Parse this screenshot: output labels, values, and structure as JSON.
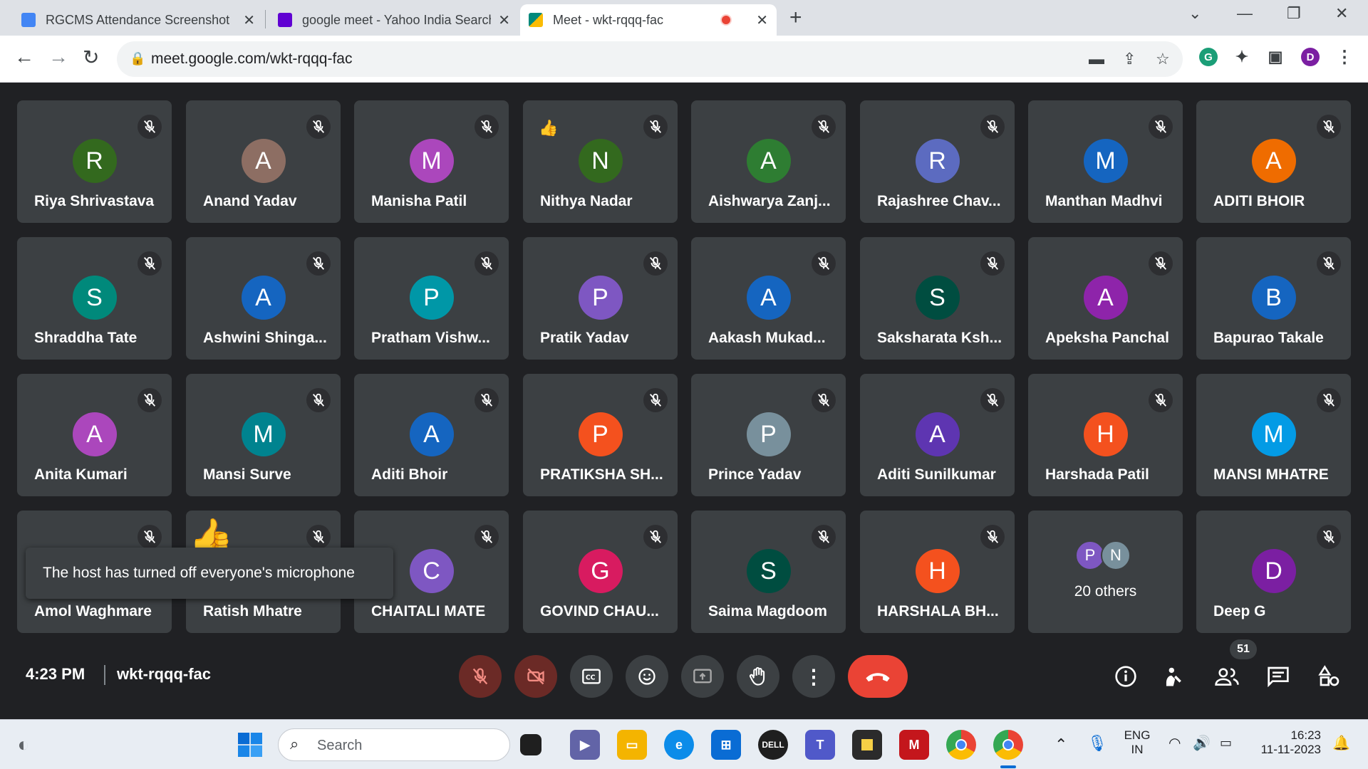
{
  "browser": {
    "tabs": [
      {
        "title": "RGCMS Attendance Screenshot",
        "icon": "docs-icon",
        "color": "#4285f4"
      },
      {
        "title": "google meet - Yahoo India Search",
        "icon": "yahoo-icon",
        "color": "#6001d2"
      },
      {
        "title": "Meet - wkt-rqqq-fac",
        "icon": "meet-icon",
        "color": "#00897b"
      }
    ],
    "url": "meet.google.com/wkt-rqqq-fac",
    "profile_initial": "D"
  },
  "participants": [
    {
      "name": "Riya Shrivastava",
      "initial": "R",
      "color": "#33691e"
    },
    {
      "name": "Anand Yadav",
      "initial": "A",
      "color": "#8d6e63"
    },
    {
      "name": "Manisha Patil",
      "initial": "M",
      "color": "#ab47bc"
    },
    {
      "name": "Nithya Nadar",
      "initial": "N",
      "color": "#33691e",
      "reaction": "👍"
    },
    {
      "name": "Aishwarya Zanj...",
      "initial": "A",
      "color": "#2e7d32"
    },
    {
      "name": "Rajashree Chav...",
      "initial": "R",
      "color": "#5c6bc0"
    },
    {
      "name": "Manthan Madhvi",
      "initial": "M",
      "color": "#1565c0"
    },
    {
      "name": "ADITI BHOIR",
      "initial": "A",
      "color": "#ef6c00"
    },
    {
      "name": "Shraddha Tate",
      "initial": "S",
      "color": "#00897b"
    },
    {
      "name": "Ashwini Shinga...",
      "initial": "A",
      "color": "#1565c0"
    },
    {
      "name": "Pratham Vishw...",
      "initial": "P",
      "color": "#0097a7"
    },
    {
      "name": "Pratik Yadav",
      "initial": "P",
      "color": "#7e57c2"
    },
    {
      "name": "Aakash Mukad...",
      "initial": "A",
      "color": "#1565c0"
    },
    {
      "name": "Saksharata Ksh...",
      "initial": "S",
      "color": "#004d40"
    },
    {
      "name": "Apeksha Panchal",
      "initial": "A",
      "color": "#8e24aa"
    },
    {
      "name": "Bapurao Takale",
      "initial": "B",
      "color": "#1565c0"
    },
    {
      "name": "Anita Kumari",
      "initial": "A",
      "color": "#ab47bc"
    },
    {
      "name": "Mansi Surve",
      "initial": "M",
      "color": "#00838f"
    },
    {
      "name": "Aditi Bhoir",
      "initial": "A",
      "color": "#1565c0"
    },
    {
      "name": "PRATIKSHA SH...",
      "initial": "P",
      "color": "#f4511e"
    },
    {
      "name": "Prince Yadav",
      "initial": "P",
      "color": "#78909c"
    },
    {
      "name": "Aditi Sunilkumar",
      "initial": "A",
      "color": "#5e35b1"
    },
    {
      "name": "Harshada Patil",
      "initial": "H",
      "color": "#f4511e"
    },
    {
      "name": "MANSI MHATRE",
      "initial": "M",
      "color": "#039be5"
    },
    {
      "name": "Amol Waghmare",
      "initial": "",
      "color": "#3c4043"
    },
    {
      "name": "Ratish Mhatre",
      "initial": "",
      "color": "#3c4043",
      "bigreaction": "👍"
    },
    {
      "name": "CHAITALI MATE",
      "initial": "C",
      "color": "#7e57c2"
    },
    {
      "name": "GOVIND CHAU...",
      "initial": "G",
      "color": "#d81b60"
    },
    {
      "name": "Saima Magdoom",
      "initial": "S",
      "color": "#004d40"
    },
    {
      "name": "HARSHALA BH...",
      "initial": "H",
      "color": "#f4511e"
    },
    {
      "name": "OTHERS",
      "initial": "",
      "color": "#3c4043"
    },
    {
      "name": "Deep G",
      "initial": "D",
      "color": "#7b1fa2"
    }
  ],
  "others": {
    "label": "20 others",
    "initials": [
      "P",
      "N"
    ],
    "colors": [
      "#7e57c2",
      "#78909c"
    ]
  },
  "toast": "The host has turned off everyone's microphone",
  "meeting": {
    "time": "4:23 PM",
    "code": "wkt-rqqq-fac",
    "participant_count": "51"
  },
  "taskbar": {
    "search_placeholder": "Search",
    "lang_line1": "ENG",
    "lang_line2": "IN",
    "clock_time": "16:23",
    "clock_date": "11-11-2023"
  }
}
